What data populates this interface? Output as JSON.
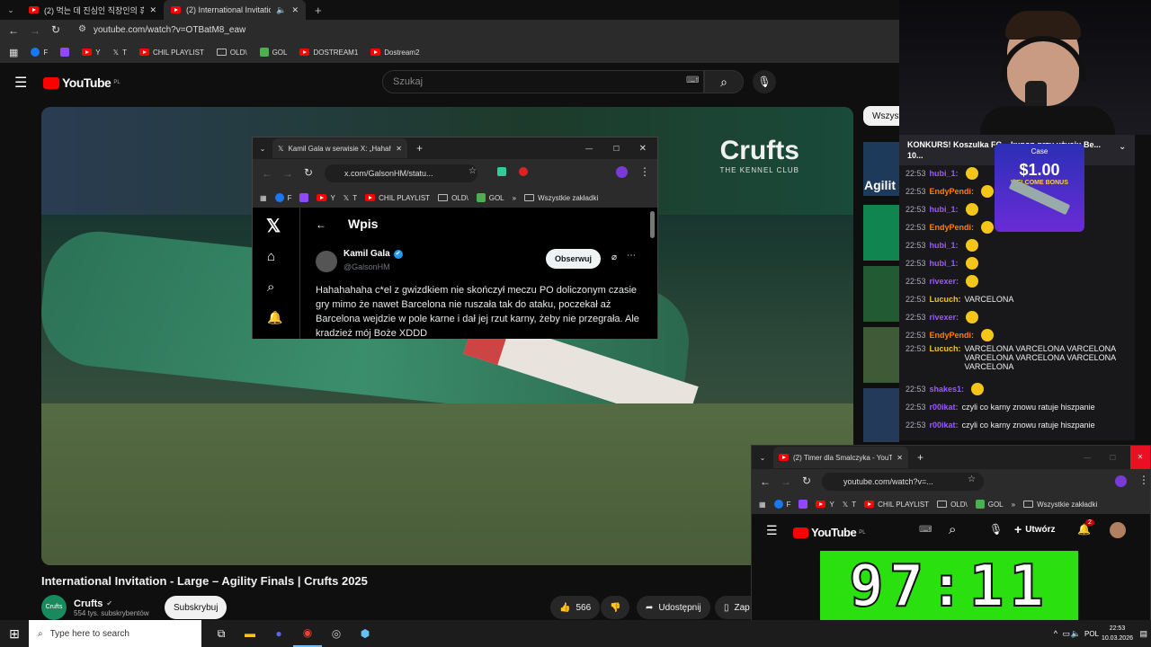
{
  "browser": {
    "tabs": [
      {
        "label": "(2) 먹는 데 진심인 직장인의 휴"
      },
      {
        "label": "(2) International Invitation"
      }
    ],
    "url": "youtube.com/watch?v=OTBatM8_eaw",
    "bookmarks": [
      "F",
      "",
      "Y",
      "T",
      "CHIL PLAYLIST",
      "OLD\\",
      "GOL",
      "DOSTREAM1",
      "Dostream2"
    ]
  },
  "youtube": {
    "logo": "YouTube",
    "logo_region": "PL",
    "search_placeholder": "Szukaj",
    "video_title": "International Invitation - Large – Agility Finals | Crufts 2025",
    "channel": "Crufts",
    "channel_avatar": "Crufts",
    "subscribers": "554 tys. subskrybentów",
    "subscribe_label": "Subskrybuj",
    "likes": "566",
    "share_label": "Udostępnij",
    "save_label": "Zap",
    "chip_label": "Wszyst",
    "sidebar_label": "Agilit",
    "watermark_title": "Crufts",
    "watermark_sub": "THE KENNEL CLUB"
  },
  "xwindow": {
    "tab_label": "Kamil Gala w serwisie X: „Hahah",
    "url": "x.com/GalsonHM/statu...",
    "bookmarks": [
      "F",
      "",
      "Y",
      "T",
      "CHIL PLAYLIST",
      "OLD\\",
      "GOL"
    ],
    "all_bookmarks": "Wszystkie zakładki",
    "header": "Wpis",
    "author": "Kamil Gala",
    "handle": "@GalsonHM",
    "follow_label": "Obserwuj",
    "post_text": "Hahahahaha c*el z gwizdkiem nie skończył meczu PO doliczonym czasie gry mimo że nawet Barcelona nie ruszała tak do ataku, poczekał aż Barcelona wejdzie w pole karne i dał jej rzut karny, żeby nie przegrała. Ale kradzież mój Boże XDDD"
  },
  "chat": {
    "pinned": "KONKURS! Koszulka FC... kupon przy użyciu Be... 10...",
    "ad_price": "$1.00",
    "ad_text": "WELCOME BONUS",
    "ad_brand": "Case",
    "lines": [
      {
        "time": "22:53",
        "user": "hubi_1:",
        "color": "#9b59ff",
        "msg": ""
      },
      {
        "time": "22:53",
        "user": "EndyPendi:",
        "color": "#ff7f00",
        "msg": ""
      },
      {
        "time": "22:53",
        "user": "hubi_1:",
        "color": "#9b59ff",
        "msg": ""
      },
      {
        "time": "22:53",
        "user": "EndyPendi:",
        "color": "#ff7f00",
        "msg": ""
      },
      {
        "time": "22:53",
        "user": "hubi_1:",
        "color": "#9b59ff",
        "msg": ""
      },
      {
        "time": "22:53",
        "user": "hubi_1:",
        "color": "#9b59ff",
        "msg": ""
      },
      {
        "time": "22:53",
        "user": "rivexer:",
        "color": "#9b59ff",
        "msg": ""
      },
      {
        "time": "22:53",
        "user": "Lucuch:",
        "color": "#f5c518",
        "msg": "VARCELONA"
      },
      {
        "time": "22:53",
        "user": "rivexer:",
        "color": "#9b59ff",
        "msg": ""
      },
      {
        "time": "22:53",
        "user": "EndyPendi:",
        "color": "#ff7f00",
        "msg": ""
      },
      {
        "time": "22:53",
        "user": "Lucuch:",
        "color": "#f5c518",
        "msg": "VARCELONA VARCELONA VARCELONA VARCELONA VARCELONA VARCELONA VARCELONA"
      },
      {
        "time": "22:53",
        "user": "shakes1:",
        "color": "#9b59ff",
        "msg": ""
      },
      {
        "time": "22:53",
        "user": "r00ikat:",
        "color": "#9b59ff",
        "msg": "czyli co karny znowu ratuje hiszpanie"
      },
      {
        "time": "22:53",
        "user": "r00ikat:",
        "color": "#9b59ff",
        "msg": "czyli co karny znowu ratuje hiszpanie"
      }
    ]
  },
  "timerwindow": {
    "tab_label": "(2) Timer dla Smalczyka - YouTu",
    "url": "youtube.com/watch?v=...",
    "bookmarks": [
      "F",
      "",
      "Y",
      "T",
      "CHIL PLAYLIST",
      "OLD\\",
      "GOL"
    ],
    "all_bookmarks": "Wszystkie zakładki",
    "create_label": "Utwórz",
    "notif_count": "2",
    "timer": "97:11"
  },
  "taskbar": {
    "search_placeholder": "Type here to search",
    "lang": "POL",
    "time": "22:53",
    "date": "10.03.2026"
  }
}
